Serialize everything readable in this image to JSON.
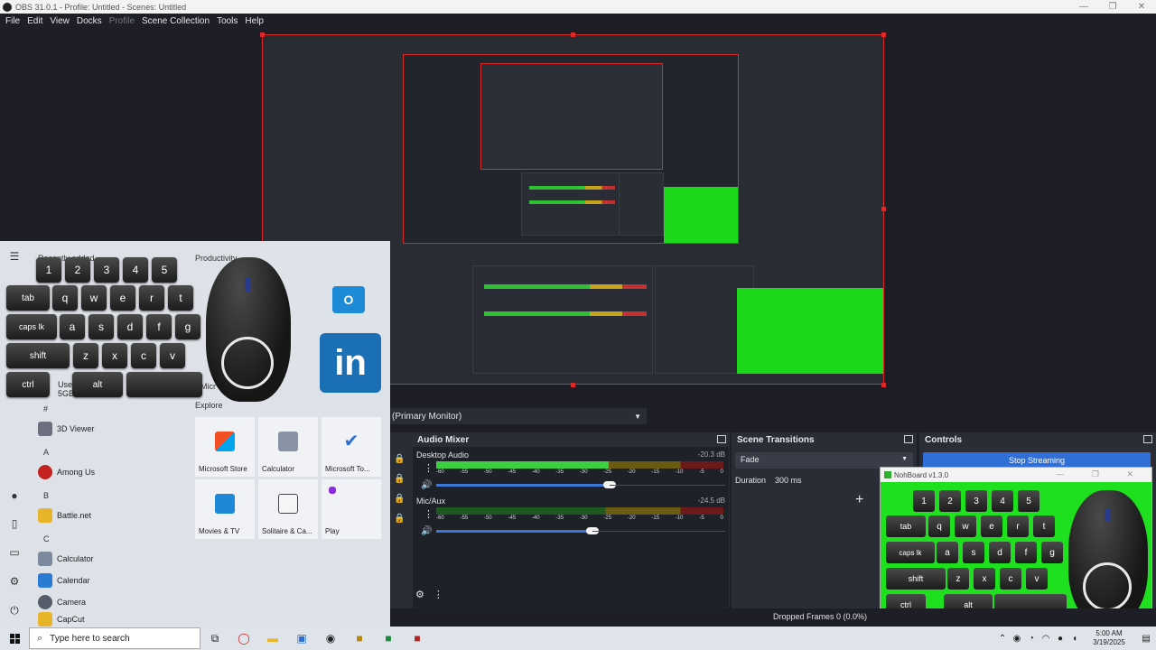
{
  "window": {
    "title": "OBS 31.0.1 - Profile: Untitled - Scenes: Untitled",
    "controls": [
      "—",
      "❐",
      "✕"
    ]
  },
  "menu": {
    "items": [
      "File",
      "Edit",
      "View",
      "Docks",
      "Profile",
      "Scene Collection",
      "Tools",
      "Help"
    ]
  },
  "source_select": {
    "value": "(Primary Monitor)"
  },
  "audio_mixer": {
    "title": "Audio Mixer",
    "ticks": [
      "-60",
      "-55",
      "-50",
      "-45",
      "-40",
      "-35",
      "-30",
      "-25",
      "-20",
      "-15",
      "-10",
      "-5",
      "0"
    ],
    "channels": [
      {
        "name": "Desktop Audio",
        "db": "-20.3 dB",
        "level": 0.6,
        "volume": 0.6
      },
      {
        "name": "Mic/Aux",
        "db": "-24.5 dB",
        "level": 0.0,
        "volume": 0.54
      }
    ]
  },
  "scene_transitions": {
    "title": "Scene Transitions",
    "transition": "Fade",
    "duration_label": "Duration",
    "duration_value": "300 ms"
  },
  "controls": {
    "title": "Controls",
    "stop_streaming": "Stop Streaming"
  },
  "status": {
    "dropped_frames": "Dropped Frames 0 (0.0%)"
  },
  "nohboard": {
    "title": "NohBoard v1.3.0"
  },
  "keyboard": {
    "row1": [
      "1",
      "2",
      "3",
      "4",
      "5"
    ],
    "row2": [
      "tab",
      "q",
      "w",
      "e",
      "r",
      "t"
    ],
    "row3_caps": "caps lk",
    "row3": [
      "a",
      "s",
      "d",
      "f",
      "g"
    ],
    "row4_shift": "shift",
    "row4": [
      "z",
      "x",
      "c",
      "v"
    ],
    "row5": [
      "ctrl",
      "alt"
    ]
  },
  "start_menu": {
    "headings": {
      "recently_added": "Recently added",
      "productivity": "Productivity",
      "explore": "Explore"
    },
    "letters": [
      "#",
      "A",
      "B",
      "C"
    ],
    "partial": {
      "use_mi": "Use Mi",
      "gb_free": "5GB Fr",
      "micr": "Micr"
    },
    "apps": [
      "3D Viewer",
      "Among Us",
      "Battle.net",
      "Calculator",
      "Calendar",
      "Camera",
      "CapCut"
    ],
    "tiles": [
      "Microsoft Store",
      "Calculator",
      "Microsoft To...",
      "Movies & TV",
      "Solitaire & Ca...",
      "Play"
    ],
    "linkedin": "in",
    "outlook": "O"
  },
  "taskbar": {
    "search_placeholder": "Type here to search",
    "time": "5:00 AM",
    "date": "3/19/2025"
  }
}
